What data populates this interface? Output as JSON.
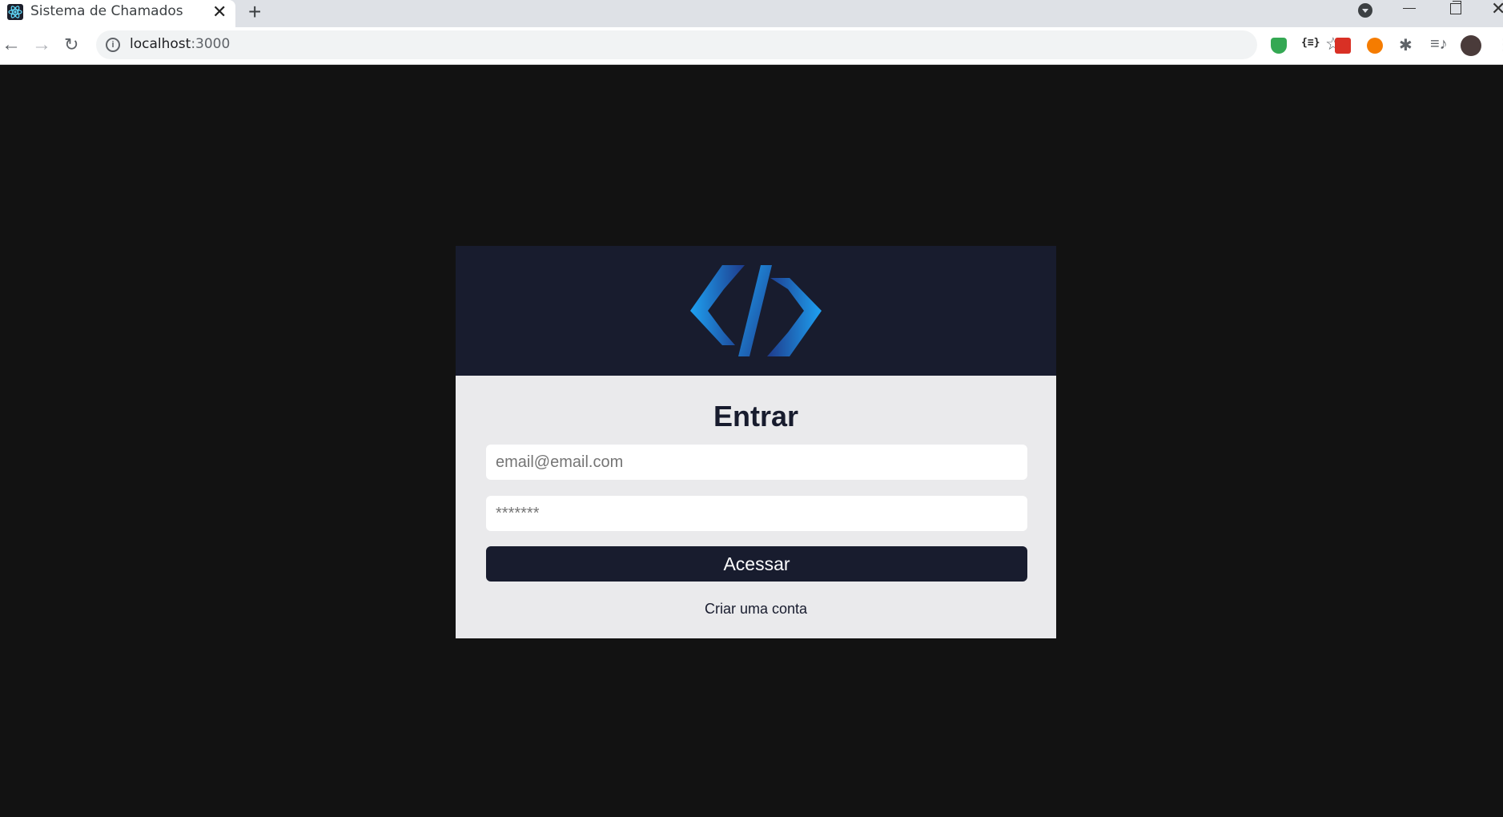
{
  "browser": {
    "tab_title": "Sistema de Chamados",
    "tab_close": "✕",
    "new_tab": "+",
    "url_host": "localhost",
    "url_port": ":3000",
    "nav_back": "←",
    "nav_forward": "→",
    "nav_reload": "↻",
    "bookmark_star": "☆",
    "ext_json_label": "{≡}",
    "ext_puzzle": "✱",
    "ext_media": "≡♪",
    "menu": "⋮",
    "win_close": "✕"
  },
  "login": {
    "title": "Entrar",
    "email_placeholder": "email@email.com",
    "password_placeholder": "*******",
    "submit_label": "Acessar",
    "signup_link": "Criar uma conta"
  },
  "colors": {
    "page_background": "#121212",
    "header_background": "#181c2e",
    "form_background": "#eaeaec",
    "logo_gradient_start": "#1e3a8a",
    "logo_gradient_end": "#1ea1f2"
  },
  "icons": {
    "logo": "code-brackets-logo",
    "favicon": "react-icon"
  }
}
